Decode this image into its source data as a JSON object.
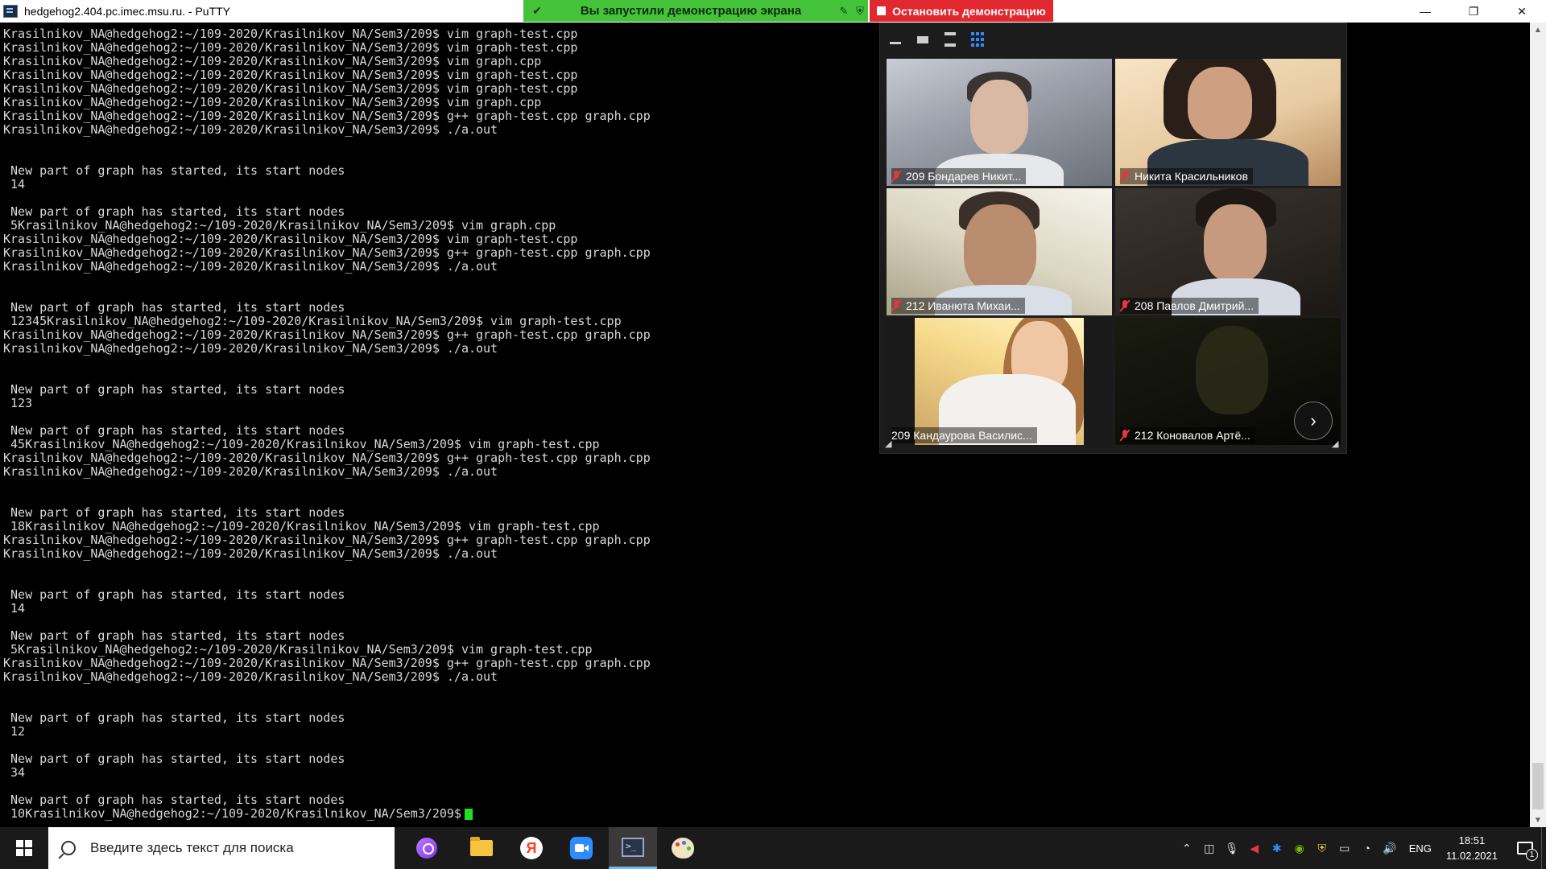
{
  "window": {
    "title": "hedgehog2.404.pc.imec.msu.ru. - PuTTY",
    "controls": {
      "minimize": "—",
      "restore": "❐",
      "close": "✕"
    }
  },
  "share_banner": {
    "text": "Вы запустили демонстрацию экрана",
    "stop_label": "Остановить демонстрацию",
    "bg_color": "#43c23a",
    "stop_color": "#e0282e"
  },
  "terminal": {
    "lines": [
      "Krasilnikov_NA@hedgehog2:~/109-2020/Krasilnikov_NA/Sem3/209$ vim graph-test.cpp",
      "Krasilnikov_NA@hedgehog2:~/109-2020/Krasilnikov_NA/Sem3/209$ vim graph-test.cpp",
      "Krasilnikov_NA@hedgehog2:~/109-2020/Krasilnikov_NA/Sem3/209$ vim graph.cpp",
      "Krasilnikov_NA@hedgehog2:~/109-2020/Krasilnikov_NA/Sem3/209$ vim graph-test.cpp",
      "Krasilnikov_NA@hedgehog2:~/109-2020/Krasilnikov_NA/Sem3/209$ vim graph-test.cpp",
      "Krasilnikov_NA@hedgehog2:~/109-2020/Krasilnikov_NA/Sem3/209$ vim graph.cpp",
      "Krasilnikov_NA@hedgehog2:~/109-2020/Krasilnikov_NA/Sem3/209$ g++ graph-test.cpp graph.cpp",
      "Krasilnikov_NA@hedgehog2:~/109-2020/Krasilnikov_NA/Sem3/209$ ./a.out",
      "",
      "",
      " New part of graph has started, its start nodes",
      " 14",
      "",
      " New part of graph has started, its start nodes",
      " 5Krasilnikov_NA@hedgehog2:~/109-2020/Krasilnikov_NA/Sem3/209$ vim graph.cpp",
      "Krasilnikov_NA@hedgehog2:~/109-2020/Krasilnikov_NA/Sem3/209$ vim graph-test.cpp",
      "Krasilnikov_NA@hedgehog2:~/109-2020/Krasilnikov_NA/Sem3/209$ g++ graph-test.cpp graph.cpp",
      "Krasilnikov_NA@hedgehog2:~/109-2020/Krasilnikov_NA/Sem3/209$ ./a.out",
      "",
      "",
      " New part of graph has started, its start nodes",
      " 12345Krasilnikov_NA@hedgehog2:~/109-2020/Krasilnikov_NA/Sem3/209$ vim graph-test.cpp",
      "Krasilnikov_NA@hedgehog2:~/109-2020/Krasilnikov_NA/Sem3/209$ g++ graph-test.cpp graph.cpp",
      "Krasilnikov_NA@hedgehog2:~/109-2020/Krasilnikov_NA/Sem3/209$ ./a.out",
      "",
      "",
      " New part of graph has started, its start nodes",
      " 123",
      "",
      " New part of graph has started, its start nodes",
      " 45Krasilnikov_NA@hedgehog2:~/109-2020/Krasilnikov_NA/Sem3/209$ vim graph-test.cpp",
      "Krasilnikov_NA@hedgehog2:~/109-2020/Krasilnikov_NA/Sem3/209$ g++ graph-test.cpp graph.cpp",
      "Krasilnikov_NA@hedgehog2:~/109-2020/Krasilnikov_NA/Sem3/209$ ./a.out",
      "",
      "",
      " New part of graph has started, its start nodes",
      " 18Krasilnikov_NA@hedgehog2:~/109-2020/Krasilnikov_NA/Sem3/209$ vim graph-test.cpp",
      "Krasilnikov_NA@hedgehog2:~/109-2020/Krasilnikov_NA/Sem3/209$ g++ graph-test.cpp graph.cpp",
      "Krasilnikov_NA@hedgehog2:~/109-2020/Krasilnikov_NA/Sem3/209$ ./a.out",
      "",
      "",
      " New part of graph has started, its start nodes",
      " 14",
      "",
      " New part of graph has started, its start nodes",
      " 5Krasilnikov_NA@hedgehog2:~/109-2020/Krasilnikov_NA/Sem3/209$ vim graph-test.cpp",
      "Krasilnikov_NA@hedgehog2:~/109-2020/Krasilnikov_NA/Sem3/209$ g++ graph-test.cpp graph.cpp",
      "Krasilnikov_NA@hedgehog2:~/109-2020/Krasilnikov_NA/Sem3/209$ ./a.out",
      "",
      "",
      " New part of graph has started, its start nodes",
      " 12",
      "",
      " New part of graph has started, its start nodes",
      " 34",
      "",
      " New part of graph has started, its start nodes",
      " 10Krasilnikov_NA@hedgehog2:~/109-2020/Krasilnikov_NA/Sem3/209$"
    ],
    "cursor_color": "#1ee01e"
  },
  "video_panel": {
    "participants": [
      {
        "name": "209 Бондарев Никит...",
        "muted": true
      },
      {
        "name": "Никита Красильников",
        "muted": true
      },
      {
        "name": "212 Иванюта Михаи...",
        "muted": true
      },
      {
        "name": "208 Павлов Дмитрий...",
        "muted": true
      },
      {
        "name": "209 Кандаурова Василис...",
        "muted": false
      },
      {
        "name": "212 Коновалов Артё...",
        "muted": true
      }
    ],
    "next_icon": "›",
    "active_view_color": "#2d8cff"
  },
  "taskbar": {
    "search_placeholder": "Введите здесь текст для поиска",
    "yandex_letter": "Я",
    "language": "ENG",
    "time": "18:51",
    "date": "11.02.2021",
    "notification_count": "1",
    "apps": [
      "alice-icon",
      "file-explorer-icon",
      "yandex-browser-icon",
      "zoom-icon",
      "putty-icon",
      "paint-icon"
    ],
    "tray_icons": [
      "chevron-up-icon",
      "camera-icon",
      "microphone-icon",
      "flag-icon",
      "bluetooth-icon",
      "nvidia-icon",
      "shield-icon",
      "battery-icon",
      "wifi-icon",
      "volume-icon"
    ]
  }
}
